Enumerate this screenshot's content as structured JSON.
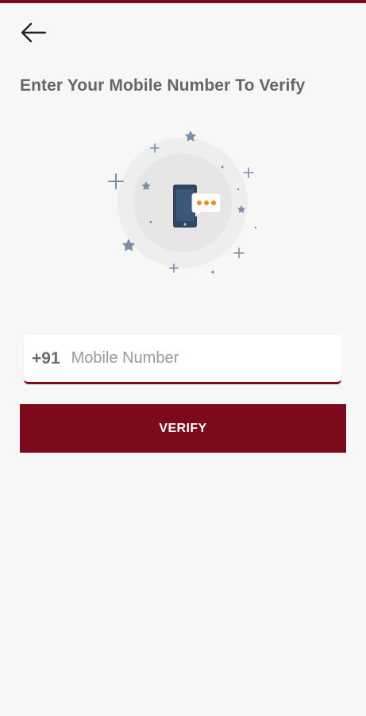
{
  "header": {
    "back_icon": "arrow-left-icon"
  },
  "title": "Enter Your Mobile Number To Verify",
  "illustration": {
    "icon": "phone-message-icon"
  },
  "form": {
    "country_code": "+91",
    "mobile_value": "",
    "mobile_placeholder": "Mobile Number"
  },
  "verify_label": "VERIFY",
  "colors": {
    "brand": "#7d0a1c",
    "background": "#f7f7f7",
    "title_text": "#666666",
    "star": "#7b8ea6",
    "phone_body": "#2f4763",
    "message_dots": "#f08a24"
  }
}
